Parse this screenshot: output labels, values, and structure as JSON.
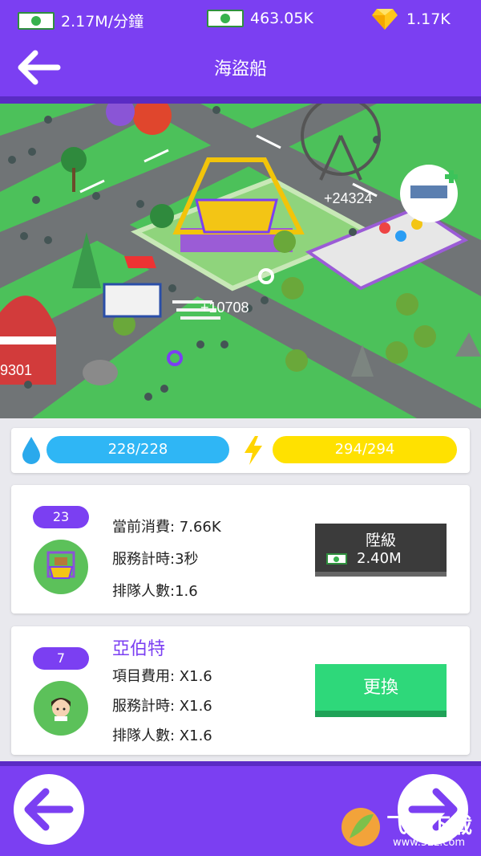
{
  "status": {
    "income_rate": "2.17M/分鐘",
    "cash": "463.05K",
    "gems": "1.17K",
    "icons": [
      "money-icon",
      "money-icon",
      "gem-icon"
    ]
  },
  "header": {
    "title": "海盜船",
    "back_icon": "arrow-left-icon"
  },
  "map": {
    "floating_texts": [
      "+24324",
      "+10708",
      "9301"
    ]
  },
  "resources": {
    "water": "228/228",
    "energy": "294/294",
    "water_fill": 1.0,
    "energy_fill": 1.0,
    "colors": {
      "water": "#2fb6f5",
      "energy": "#ffe100"
    }
  },
  "ride": {
    "level": "23",
    "consumption": "當前消費: 7.66K",
    "service_time": "服務計時:3秒",
    "queue": "排隊人數:1.6",
    "upgrade_label": "陞級",
    "upgrade_cost": "2.40M"
  },
  "staff": {
    "level": "7",
    "name": "亞伯特",
    "item_cost": "項目費用: X1.6",
    "service_time": "服務計時: X1.6",
    "queue": "排隊人數: X1.6",
    "change_label": "更換"
  },
  "watermark": {
    "text": "飞翔下载",
    "url": "www.52z.com"
  },
  "colors": {
    "accent": "#7b3ff2",
    "green_button": "#2ed87a",
    "dark_button": "#3b3b3b"
  }
}
